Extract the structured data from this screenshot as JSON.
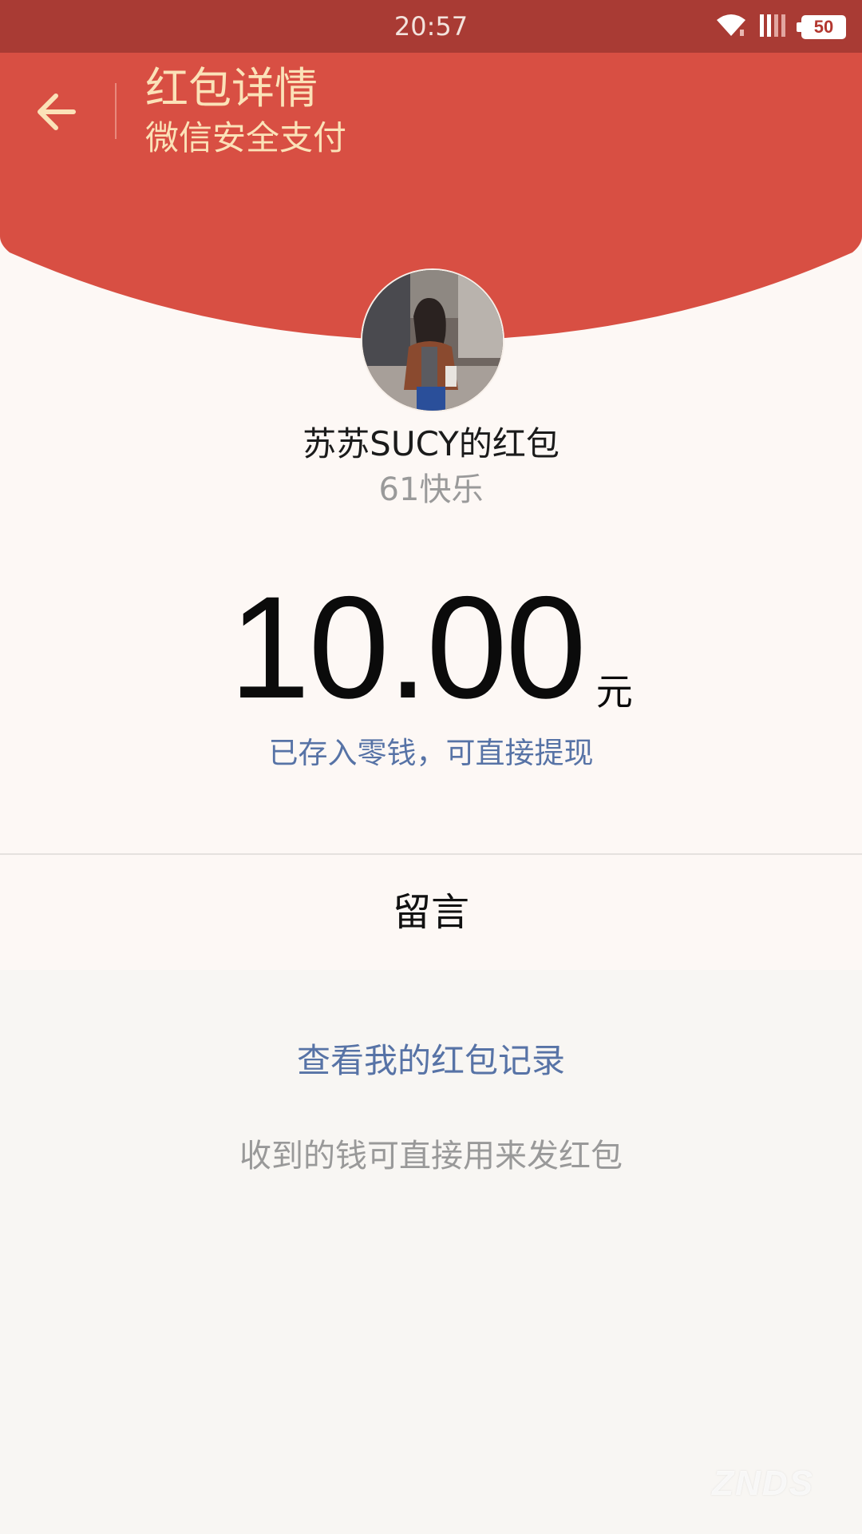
{
  "status_bar": {
    "time": "20:57",
    "battery": "50",
    "icons": [
      "wifi-icon",
      "signal-icon",
      "battery-icon"
    ]
  },
  "header": {
    "title": "红包详情",
    "subtitle": "微信安全支付",
    "back_icon": "arrow-left-icon"
  },
  "packet": {
    "sender": "苏苏SUCY的红包",
    "greeting": "61快乐",
    "amount": "10.00",
    "unit": "元",
    "stored_note": "已存入零钱，可直接提现"
  },
  "message": {
    "label": "留言"
  },
  "footer": {
    "records_link": "查看我的红包记录",
    "hint": "收到的钱可直接用来发红包"
  },
  "watermark": "ZNDS",
  "colors": {
    "status_bar": "#a93b34",
    "header_red": "#d84f43",
    "header_text": "#fbe2b8",
    "link_blue": "#5773a6",
    "panel_bg": "#fdf8f5",
    "page_bg": "#f8f6f3"
  }
}
